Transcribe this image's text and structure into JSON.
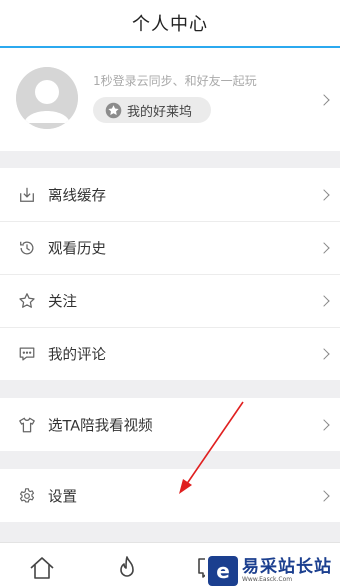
{
  "header": {
    "title": "个人中心"
  },
  "profile": {
    "prompt": "1秒登录云同步、和好友一起玩",
    "button_label": "我的好莱坞",
    "avatar_icon": "default-avatar-icon",
    "star_icon": "star-icon"
  },
  "menu": {
    "items": [
      {
        "label": "离线缓存",
        "icon": "download-icon"
      },
      {
        "label": "观看历史",
        "icon": "history-icon"
      },
      {
        "label": "关注",
        "icon": "star-outline-icon"
      },
      {
        "label": "我的评论",
        "icon": "comment-icon"
      }
    ],
    "companion": {
      "label": "选TA陪我看视频",
      "icon": "shirt-icon"
    },
    "settings": {
      "label": "设置",
      "icon": "gear-icon"
    }
  },
  "footer": {
    "tabs": [
      {
        "icon": "home-icon"
      },
      {
        "icon": "fire-icon"
      },
      {
        "icon": "chat-icon"
      }
    ]
  },
  "watermark": {
    "title": "易采站长站",
    "subtitle": "Www.Easck.Com",
    "logo_text": "e"
  },
  "colors": {
    "accent": "#2ba9ef",
    "background": "#efeff1",
    "annotation": "#e02020",
    "watermark": "#1b3f8f"
  }
}
